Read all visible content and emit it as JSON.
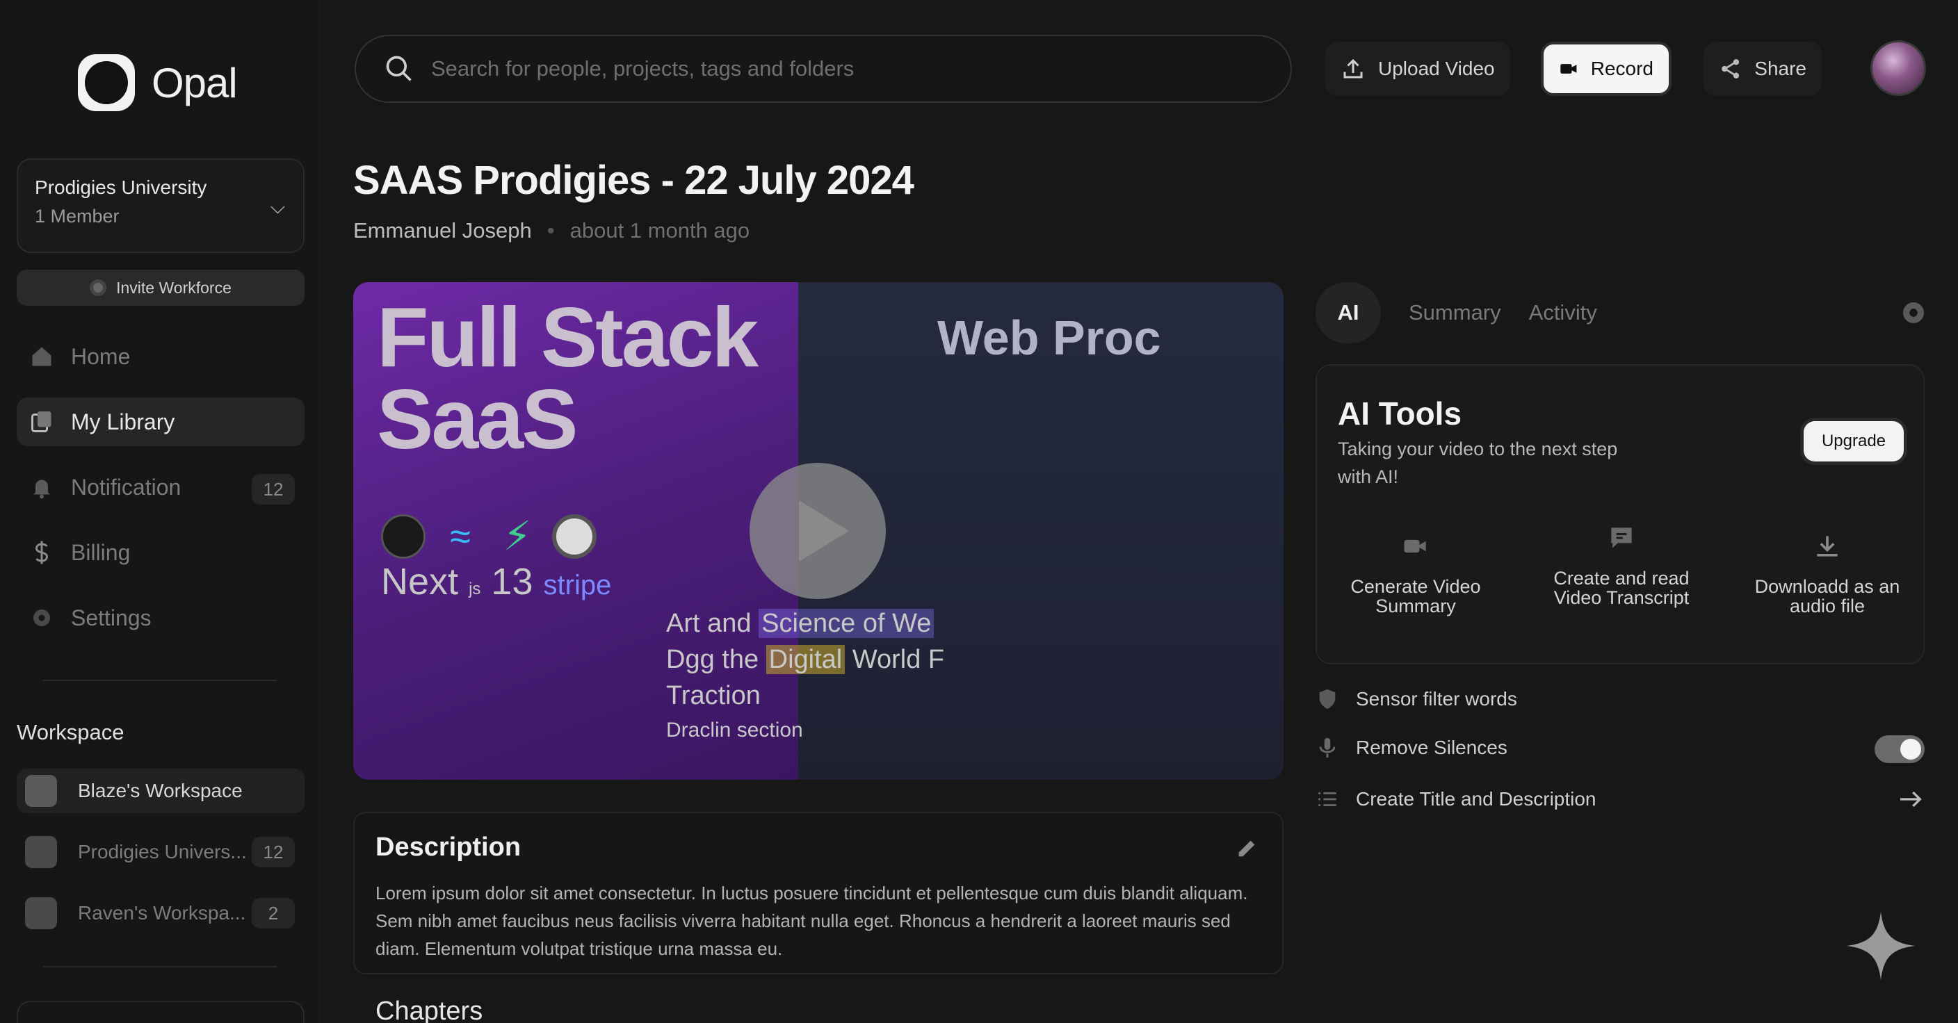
{
  "app": {
    "name": "Opal"
  },
  "workspace_selector": {
    "name": "Prodigies University",
    "members": "1 Member"
  },
  "invite": {
    "label": "Invite Workforce"
  },
  "nav": [
    {
      "label": "Home",
      "icon": "home-icon"
    },
    {
      "label": "My Library",
      "icon": "library-icon"
    },
    {
      "label": "Notification",
      "icon": "bell-icon",
      "badge": "12"
    },
    {
      "label": "Billing",
      "icon": "dollar-icon"
    },
    {
      "label": "Settings",
      "icon": "gear-icon"
    }
  ],
  "workspace_section": {
    "heading": "Workspace",
    "items": [
      {
        "label": "Blaze's Workspace",
        "badge": ""
      },
      {
        "label": "Prodigies Univers...",
        "badge": "12"
      },
      {
        "label": "Raven's Workspa...",
        "badge": "2"
      }
    ]
  },
  "search": {
    "placeholder": "Search for people, projects, tags and folders"
  },
  "toolbar": {
    "upload_label": "Upload Video",
    "record_label": "Record",
    "share_label": "Share"
  },
  "video_page": {
    "title": "SAAS Prodigies - 22 July 2024",
    "author": "Emmanuel Joseph",
    "time": "about 1 month ago"
  },
  "thumbnail": {
    "headline_line1": "Full Stack",
    "headline_line2": "SaaS",
    "tech_next": "Next",
    "tech_js": "js",
    "tech_13": "13",
    "tech_stripe": "stripe",
    "brand": "Web Proc",
    "caption_1a": "Art and",
    "caption_1b": "Science of We",
    "caption_2a": "Dgg the",
    "caption_2b": "Digital",
    "caption_2c": "World F",
    "caption_3": "Traction",
    "caption_4": "Draclin section"
  },
  "description": {
    "title": "Description",
    "body": "Lorem ipsum dolor sit amet consectetur. In luctus posuere tincidunt et pellentesque cum duis blandit aliquam. Sem nibh amet faucibus neus facilisis viverra habitant nulla eget. Rhoncus a hendrerit a laoreet mauris sed diam. Elementum volutpat tristique urna massa eu."
  },
  "chapters": {
    "title": "Chapters"
  },
  "tabs": [
    {
      "label": "AI",
      "active": true
    },
    {
      "label": "Summary",
      "active": false
    },
    {
      "label": "Activity",
      "active": false
    }
  ],
  "ai_tools": {
    "title": "AI Tools",
    "subtitle": "Taking your video to the next step with AI!",
    "upgrade_label": "Upgrade",
    "tools": [
      {
        "label": "Cenerate Video Summary",
        "icon": "video-camera-icon"
      },
      {
        "label": "Create and read Video Transcript",
        "icon": "chat-bubble-icon"
      },
      {
        "label": "Downloadd as an audio file",
        "icon": "download-icon"
      }
    ]
  },
  "options": {
    "sensor_filter": "Sensor filter words",
    "remove_silences": "Remove Silences",
    "remove_silences_on": true,
    "create_title": "Create Title and Description"
  }
}
